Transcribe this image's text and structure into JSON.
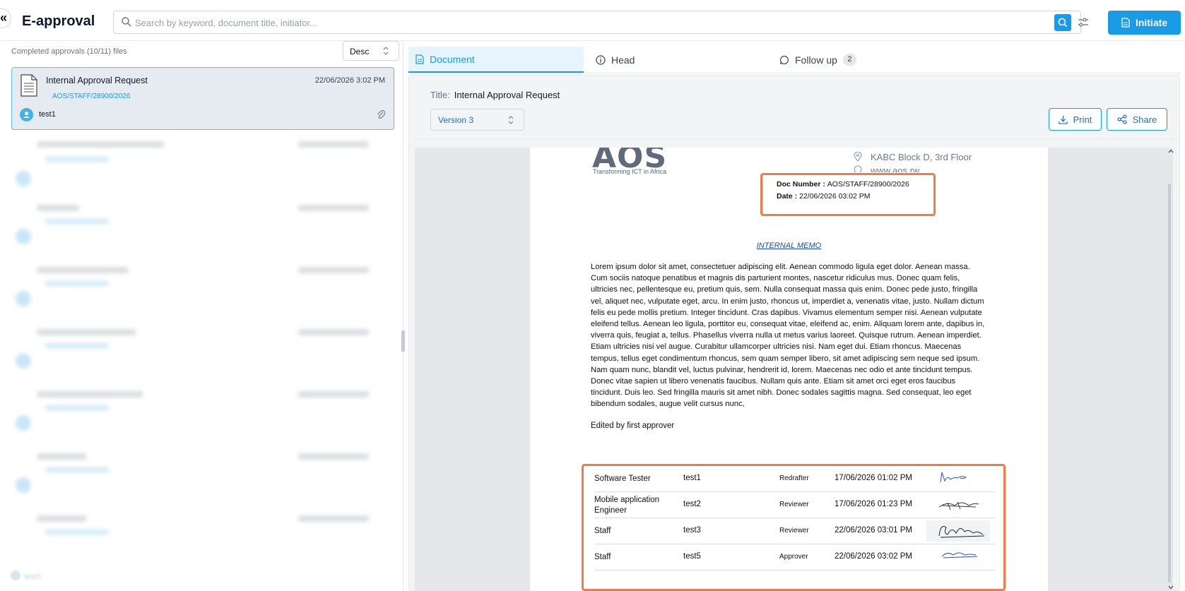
{
  "header": {
    "collapse_glyph": "«",
    "app_title": "E-approval",
    "search_placeholder": "Search by keyword, document title, initiator...",
    "initiate_label": "Initiate"
  },
  "left_panel": {
    "completed_label": "Completed approvals (10/11) files",
    "sort_value": "Desc",
    "active_item": {
      "title": "Internal Approval Request",
      "date": "22/06/2026 3:02 PM",
      "reference": "AOS/STAFF/28900/2026",
      "user": "test1"
    },
    "blurred_user": "test5"
  },
  "tabs": [
    {
      "label": "Document"
    },
    {
      "label": "Head"
    },
    {
      "label": "Follow up",
      "badge": "2"
    }
  ],
  "document_panel": {
    "title_key": "Title:",
    "title_value": "Internal Approval Request",
    "version_value": "Version 3",
    "print_label": "Print",
    "share_label": "Share"
  },
  "document": {
    "logo_text": "AOS",
    "logo_tagline": "Transforming ICT in Africa",
    "address_line1": "KABC Block D, 3rd Floor",
    "address_line2": "www.aos.rw",
    "doc_number_label": "Doc  Number",
    "doc_number_value": "AOS/STAFF/28900/2026",
    "date_label": "Date",
    "date_value": "22/06/2026 03:02 PM",
    "memo_title": "INTERNAL MEMO",
    "body": "Lorem ipsum dolor sit amet, consectetuer adipiscing elit. Aenean commodo ligula eget dolor. Aenean massa. Cum sociis natoque penatibus et magnis dis parturient montes, nascetur ridiculus mus. Donec quam felis, ultricies nec, pellentesque eu, pretium quis, sem. Nulla consequat massa quis enim. Donec pede justo, fringilla vel, aliquet nec, vulputate eget, arcu. In enim justo, rhoncus ut, imperdiet a, venenatis vitae, justo. Nullam dictum felis eu pede mollis pretium. Integer tincidunt. Cras dapibus. Vivamus elementum semper nisi. Aenean vulputate eleifend tellus. Aenean leo ligula, porttitor eu, consequat vitae, eleifend ac, enim. Aliquam lorem ante, dapibus in, viverra quis, feugiat a, tellus. Phasellus viverra nulla ut metus varius laoreet. Quisque rutrum. Aenean imperdiet. Etiam ultricies nisi vel augue. Curabitur ullamcorper ultricies nisi. Nam eget dui. Etiam rhoncus. Maecenas tempus, tellus eget condimentum rhoncus, sem quam semper libero, sit amet adipiscing sem neque sed ipsum. Nam quam nunc, blandit vel, luctus pulvinar, hendrerit id, lorem. Maecenas nec odio et ante tincidunt tempus. Donec vitae sapien ut libero venenatis faucibus. Nullam quis ante. Etiam sit amet orci eget eros faucibus tincidunt. Duis leo. Sed fringilla mauris sit amet nibh. Donec sodales sagittis magna. Sed consequat, leo eget bibendum sodales, augue velit cursus nunc,",
    "edited_note": "Edited by first approver",
    "signatures": [
      {
        "role": "Software Tester",
        "name": "test1",
        "type": "Redrafter",
        "date": "17/06/2026 01:02 PM"
      },
      {
        "role": "Mobile application Engineer",
        "name": "test2",
        "type": "Reviewer",
        "date": "17/06/2026 01:23 PM"
      },
      {
        "role": "Staff",
        "name": "test3",
        "type": "Reviewer",
        "date": "22/06/2026 03:01 PM"
      },
      {
        "role": "Staff",
        "name": "test5",
        "type": "Approver",
        "date": "22/06/2026 03:02 PM"
      }
    ]
  },
  "colors": {
    "accent": "#1a9be6",
    "highlight_border": "#ef7b45",
    "active_card_bg": "#e5ebf0"
  }
}
